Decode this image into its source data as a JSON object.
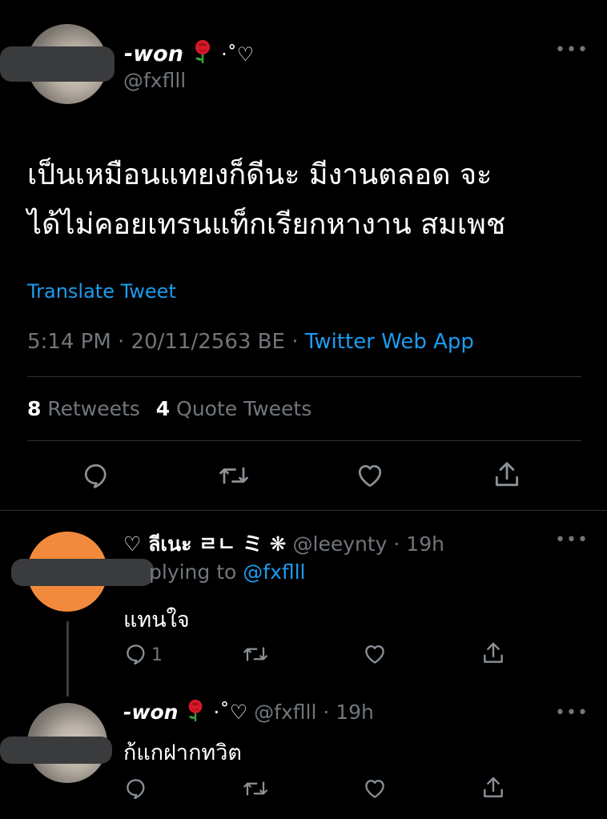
{
  "main_tweet": {
    "display_name": "-won",
    "name_suffix": "·˚♡",
    "handle": "@fxflll",
    "text_line1": "เป็นเหมือนแทยงก็ดีนะ มีงานตลอด จะ",
    "text_line2": "ได้ไม่คอยเทรนแท็กเรียกหางาน สมเพช",
    "translate": "Translate Tweet",
    "time_date": "5:14 PM · 20/11/2563 BE · ",
    "source": "Twitter Web App",
    "retweets_count": "8",
    "retweets_label": "Retweets",
    "quotes_count": "4",
    "quotes_label": "Quote Tweets"
  },
  "reply1": {
    "display_name": "♡ ลีเนะ ㄹㄴ ミ ❋",
    "handle_time": "@leeynty · 19h",
    "replying_prefix": "plying to ",
    "replying_handle": "@fxflll",
    "text": "แทนใจ",
    "reply_count": "1"
  },
  "reply2": {
    "display_name": "-won",
    "name_suffix": "·˚♡",
    "handle_time": "@fxflll · 19h",
    "text": "ก้แกฝากทวิต"
  },
  "colors": {
    "accent": "#1d9bf0",
    "muted": "#71767b",
    "reply_avatar": "#f28a3e"
  }
}
